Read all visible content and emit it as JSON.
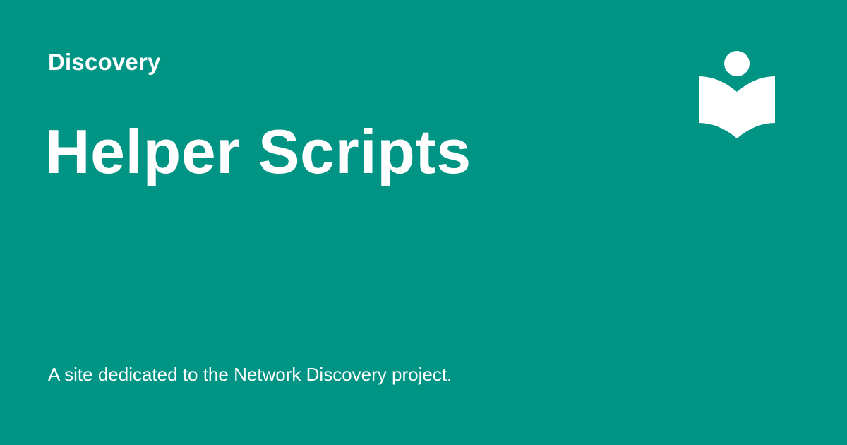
{
  "header": {
    "site_name": "Discovery"
  },
  "main": {
    "title": "Helper Scripts",
    "description": "A site dedicated to the Network Discovery project."
  },
  "logo": {
    "icon": "reader-book-icon"
  },
  "colors": {
    "background": "#009485",
    "text": "#ffffff",
    "logo": "#ffffff"
  }
}
